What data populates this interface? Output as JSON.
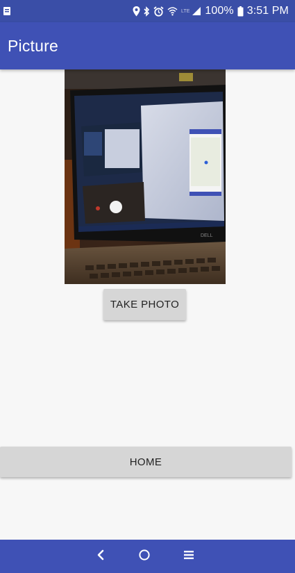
{
  "status_bar": {
    "time": "3:51 PM",
    "battery_percent": "100%",
    "network_label": "LTE",
    "icons": [
      "sim-notification-icon",
      "location-icon",
      "bluetooth-icon",
      "alarm-icon",
      "wifi-icon",
      "signal-icon",
      "battery-icon"
    ]
  },
  "app_bar": {
    "title": "Picture"
  },
  "photo": {
    "description_icon": "captured-photo",
    "laptop_brand": "DELL"
  },
  "buttons": {
    "take_photo": "TAKE PHOTO",
    "home": "HOME"
  },
  "nav_bar": {
    "icons": [
      "back-icon",
      "home-circle-icon",
      "recent-apps-icon"
    ]
  },
  "colors": {
    "status_bar": "#3a4ea7",
    "primary": "#3f51b5",
    "background": "#f7f7f7",
    "button": "#d6d6d6"
  }
}
